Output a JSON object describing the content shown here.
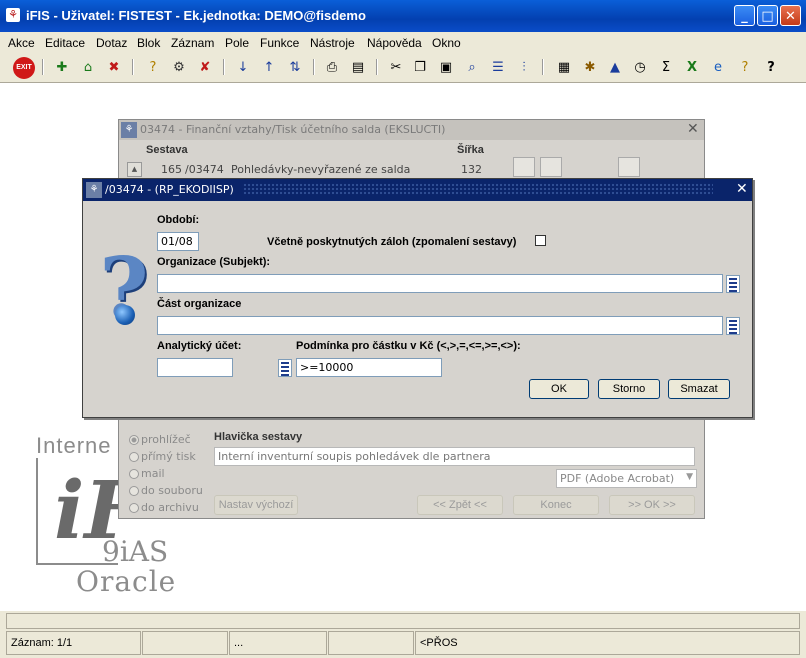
{
  "window": {
    "title": "iFIS - Uživatel: FISTEST - Ek.jednotka: DEMO@fisdemo",
    "minimize_icon": "minimize-icon",
    "maximize_icon": "maximize-icon",
    "close_icon": "close-icon"
  },
  "menu": [
    "Akce",
    "Editace",
    "Dotaz",
    "Blok",
    "Záznam",
    "Pole",
    "Funkce",
    "Nástroje",
    "Nápověda",
    "Okno"
  ],
  "toolbar": {
    "exit_label": "EXIT",
    "icons": [
      "exit-icon",
      "add-record-icon",
      "save-icon",
      "delete-record-icon",
      "query-enter-icon",
      "query-execute-icon",
      "query-cancel-icon",
      "sort-asc-icon",
      "sort-desc-icon",
      "sort-multi-icon",
      "print-icon",
      "print-preview-icon",
      "cut-icon",
      "copy-icon",
      "paste-icon",
      "zoom-icon",
      "list-icon",
      "filter-icon",
      "calculator-icon",
      "settings-icon",
      "chart-icon",
      "calendar-icon",
      "sum-icon",
      "excel-icon",
      "ie-icon",
      "help-topic-icon",
      "help-icon"
    ]
  },
  "background_window": {
    "title": "03474 - Finanční vztahy/Tisk účetního salda (EKSLUCTI)",
    "col_sestava": "Sestava",
    "col_sirka": "Šířka",
    "row": {
      "num": "165",
      "code": "/03474",
      "name": "Pohledávky-nevyřazené ze salda",
      "width": "132"
    },
    "output_options": [
      "prohlížeč",
      "přímý tisk",
      "mail",
      "do souboru",
      "do archivu"
    ],
    "header_label": "Hlavička sestavy",
    "header_value": "Interní inventurní soupis pohledávek dle partnera",
    "format_value": "PDF (Adobe Acrobat)",
    "reset_button": "Nastav výchozí",
    "back_button": "<< Zpět <<",
    "end_button": "Konec",
    "ok_button": ">> OK >>"
  },
  "dialog": {
    "title": "/03474 - (RP_EKODIISP)",
    "period_label": "Období:",
    "period_value": "01/08",
    "advances_label": "Včetně poskytnutých záloh (zpomalení sestavy)",
    "org_label": "Organizace (Subjekt):",
    "org_value": "",
    "org_part_label": "Část organizace",
    "org_part_value": "",
    "account_label": "Analytický účet:",
    "account_value": "",
    "condition_label": "Podmínka pro částku v Kč (<,>,=,<=,>=,<>):",
    "condition_value": ">=10000",
    "ok_button": "OK",
    "cancel_button": "Storno",
    "clear_button": "Smazat"
  },
  "branding": {
    "internet": "Interne",
    "ias": "9iAS",
    "oracle": "Oracle"
  },
  "statusbar": {
    "record": "Záznam: 1/1",
    "ellipsis": "...",
    "mode": "<PŘOS"
  }
}
